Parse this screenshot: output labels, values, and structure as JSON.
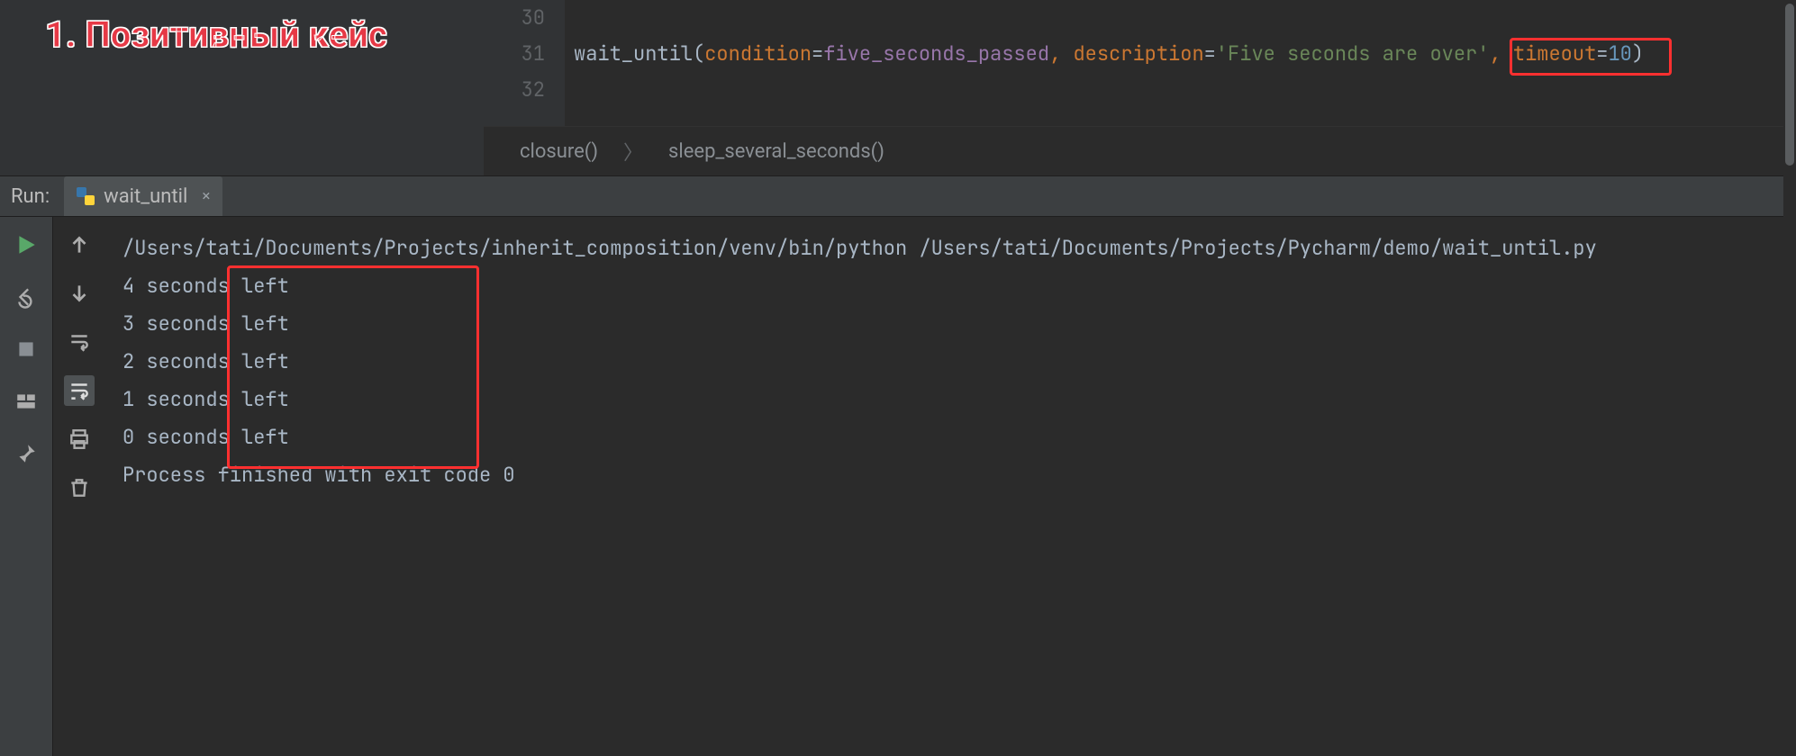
{
  "overlay": {
    "title": "1. Позитивный кейс"
  },
  "editor": {
    "line_numbers": [
      "30",
      "31",
      "32"
    ],
    "code_line": {
      "fn": "wait_until",
      "paren_open": "(",
      "arg1_name": "condition",
      "eq1": "=",
      "arg1_val": "five_seconds_passed",
      "comma1": ", ",
      "arg2_name": "description",
      "eq2": "=",
      "arg2_val": "'Five seconds are over'",
      "comma2": ", ",
      "arg3_name": "timeout",
      "eq3": "=",
      "arg3_val": "10",
      "paren_close": ")"
    }
  },
  "breadcrumbs": {
    "item1": "closure()",
    "item2": "sleep_several_seconds()"
  },
  "run": {
    "label": "Run:",
    "tab_name": "wait_until",
    "tab_close_glyph": "×"
  },
  "console": {
    "cmd": "/Users/tati/Documents/Projects/inherit_composition/venv/bin/python /Users/tati/Documents/Projects/Pycharm/demo/wait_until.py",
    "out": [
      "4 seconds left",
      "3 seconds left",
      "2 seconds left",
      "1 seconds left",
      "0 seconds left"
    ],
    "blank": "",
    "exit": "Process finished with exit code 0"
  },
  "colors": {
    "accent_red": "#ff3030",
    "run_green": "#59a869",
    "icon_grey": "#adadad"
  }
}
